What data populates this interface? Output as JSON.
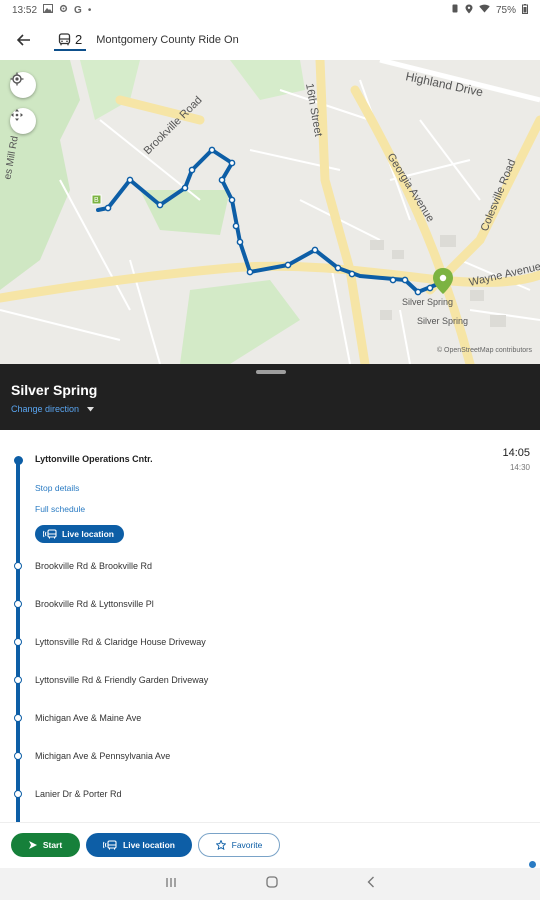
{
  "status_bar": {
    "time": "13:52",
    "left_icons": [
      "image-icon",
      "settings-icon",
      "google-icon",
      "dot-icon"
    ],
    "battery": "75%",
    "right_icons": [
      "vibrate-icon",
      "location-icon",
      "wifi-icon",
      "battery-icon"
    ]
  },
  "app_bar": {
    "route_number": "2",
    "agency": "Montgomery County Ride On"
  },
  "map": {
    "labels": [
      "Highland Drive",
      "Brookville Road",
      "16th Street",
      "Georgia Avenue",
      "Colesville Road",
      "Wayne Avenue",
      "Silver Spring",
      "Silver Spring",
      "es Mill Rd"
    ],
    "attribution": "© OpenStreetMap contributors",
    "route_color": "#0d5ea6",
    "destination_marker_color": "#7cb342"
  },
  "direction": {
    "destination": "Silver Spring",
    "change_label": "Change direction"
  },
  "stops": {
    "first": {
      "name": "Lyttonville Operations Cntr.",
      "time": "14:05",
      "time_scheduled": "14:30",
      "stop_details": "Stop details",
      "full_schedule": "Full schedule",
      "live_location": "Live location"
    },
    "list": [
      "Brookville Rd & Brookville Rd",
      "Brookville Rd & Lyttonsville Pl",
      "Lyttonsville Rd & Claridge House Driveway",
      "Lyttonsville Rd & Friendly Garden Driveway",
      "Michigan Ave & Maine Ave",
      "Michigan Ave & Pennsylvania Ave",
      "Lanier Dr & Porter Rd"
    ]
  },
  "actions": {
    "start": "Start",
    "live_location": "Live location",
    "favorite": "Favorite"
  }
}
